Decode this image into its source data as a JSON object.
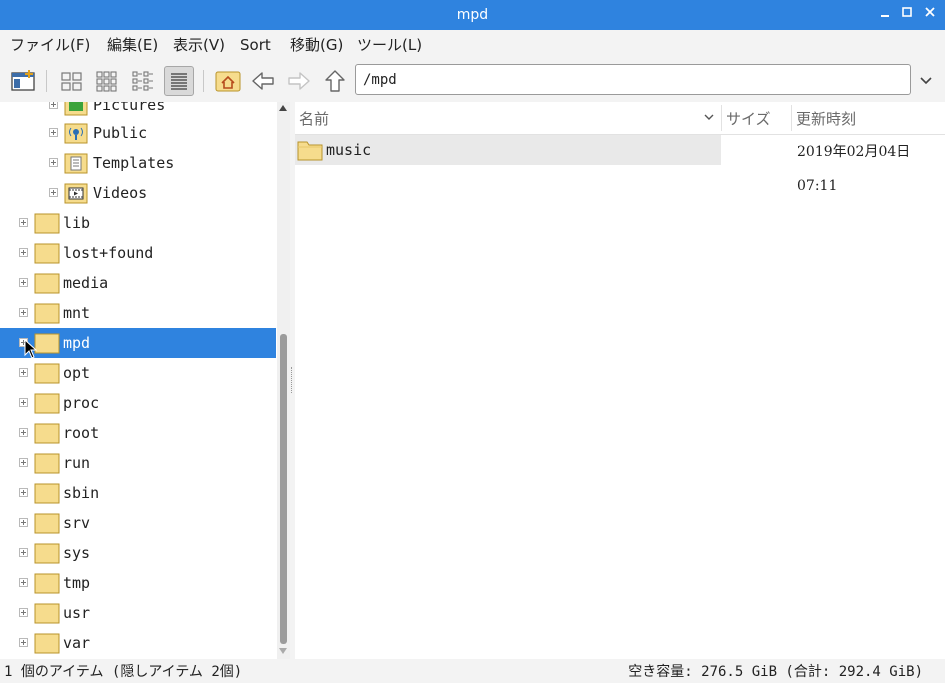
{
  "window": {
    "title": "mpd"
  },
  "menu": [
    "ファイル(F)",
    "編集(E)",
    "表示(V)",
    "Sort",
    "移動(G)",
    "ツール(L)"
  ],
  "toolbar": {
    "path_value": "/mpd",
    "icons": [
      "new-window-icon",
      "icon-view-icon",
      "thumbnail-view-icon",
      "compact-view-icon",
      "detailed-list-view-icon",
      "home-icon",
      "back-arrow-icon",
      "forward-arrow-icon",
      "up-arrow-icon"
    ]
  },
  "tree": {
    "sub_items": [
      {
        "label": "Pictures",
        "icon": "pictures-folder-icon"
      },
      {
        "label": "Public",
        "icon": "public-folder-icon"
      },
      {
        "label": "Templates",
        "icon": "templates-folder-icon"
      },
      {
        "label": "Videos",
        "icon": "videos-folder-icon"
      }
    ],
    "items": [
      {
        "label": "lib"
      },
      {
        "label": "lost+found"
      },
      {
        "label": "media"
      },
      {
        "label": "mnt"
      },
      {
        "label": "mpd",
        "selected": true
      },
      {
        "label": "opt"
      },
      {
        "label": "proc"
      },
      {
        "label": "root"
      },
      {
        "label": "run"
      },
      {
        "label": "sbin"
      },
      {
        "label": "srv"
      },
      {
        "label": "sys"
      },
      {
        "label": "tmp"
      },
      {
        "label": "usr"
      },
      {
        "label": "var"
      }
    ]
  },
  "list": {
    "headers": {
      "name": "名前",
      "size": "サイズ",
      "modified": "更新時刻"
    },
    "rows": [
      {
        "name": "music",
        "size": "",
        "modified": "2019年02月04日 07:11"
      }
    ]
  },
  "status": {
    "left": "1 個のアイテム (隠しアイテム 2個)",
    "right": "空き容量: 276.5 GiB (合計: 292.4 GiB)"
  },
  "colors": {
    "titlebar": "#2f83df",
    "selection": "#2f83df",
    "folder": "#f6dc8d"
  }
}
